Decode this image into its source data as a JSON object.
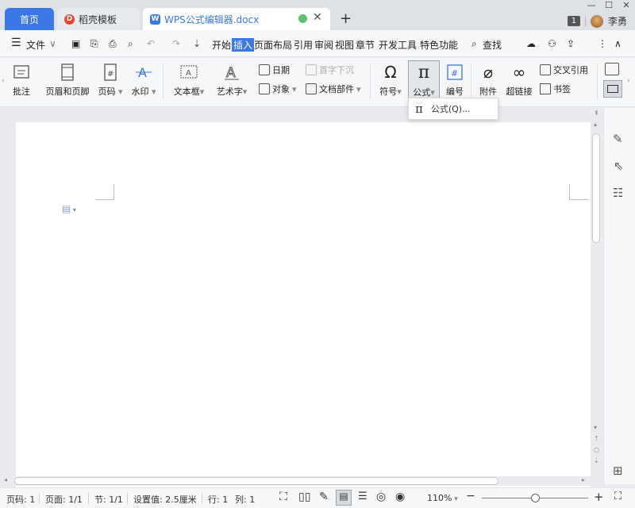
{
  "tabs": {
    "home": "首页",
    "daoke": "稻壳模板",
    "doc": "WPS公式编辑器.docx"
  },
  "window": {
    "badge": "1",
    "user": "李勇"
  },
  "menu": {
    "file": "文件",
    "items": [
      "开始",
      "插入",
      "页面布局",
      "引用",
      "审阅",
      "视图",
      "章节",
      "开发工具",
      "特色功能"
    ],
    "active": "插入",
    "search": "查找"
  },
  "ribbon": {
    "comment": "批注",
    "header_footer": "页眉和页脚",
    "page_number": "页码",
    "watermark": "水印",
    "textbox": "文本框",
    "wordart": "艺术字",
    "date": "日期",
    "object": "对象",
    "dropcap": "首字下沉",
    "doc_parts": "文档部件",
    "symbol": "符号",
    "formula": "公式",
    "number": "编号",
    "attachment": "附件",
    "hyperlink": "超链接",
    "crossref": "交叉引用",
    "bookmark": "书签"
  },
  "dropdown": {
    "item": "公式(Q)..."
  },
  "status": {
    "page_no": "页码: 1",
    "pages": "页面: 1/1",
    "section": "节: 1/1",
    "setting": "设置值: 2.5厘米",
    "row": "行: 1",
    "col": "列: 1",
    "zoom": "110%"
  },
  "colors": {
    "accent": "#3b77e5"
  }
}
